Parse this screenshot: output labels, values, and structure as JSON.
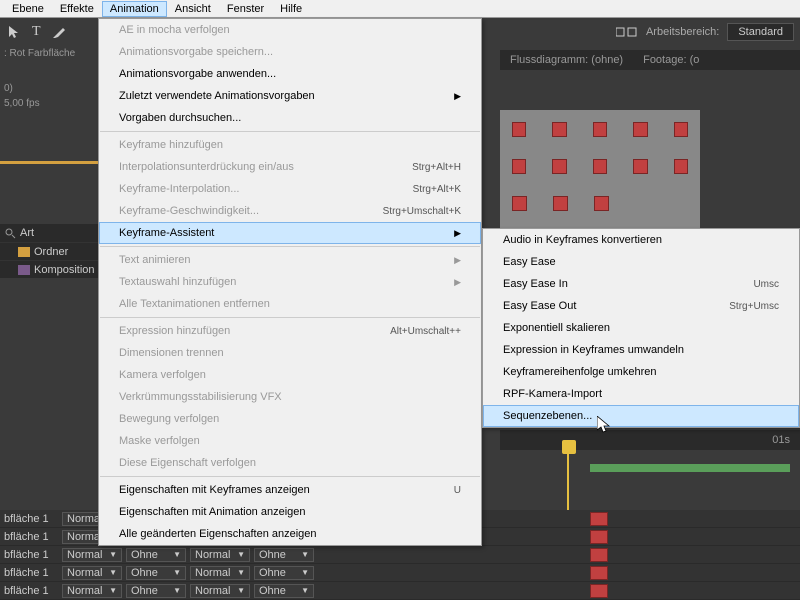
{
  "menubar": [
    "Ebene",
    "Effekte",
    "Animation",
    "Ansicht",
    "Fenster",
    "Hilfe"
  ],
  "menubar_active": "Animation",
  "workspace": {
    "label": "Arbeitsbereich:",
    "value": "Standard"
  },
  "project": {
    "title_line": ": Rot Farbfläche",
    "info1": "0)",
    "info2": "5,00 fps",
    "header": "Art",
    "rows": [
      "Ordner",
      "Komposition"
    ]
  },
  "panel_tabs": {
    "flow": "Flussdiagramm: (ohne)",
    "footage": "Footage: (o"
  },
  "dropdown_main": {
    "sections": [
      [
        {
          "label": "AE in mocha verfolgen",
          "disabled": true
        },
        {
          "label": "Animationsvorgabe speichern...",
          "disabled": true
        },
        {
          "label": "Animationsvorgabe anwenden..."
        },
        {
          "label": "Zuletzt verwendete Animationsvorgaben",
          "arrow": true
        },
        {
          "label": "Vorgaben durchsuchen..."
        }
      ],
      [
        {
          "label": "Keyframe hinzufügen",
          "disabled": true
        },
        {
          "label": "Interpolationsunterdrückung ein/aus",
          "shortcut": "Strg+Alt+H",
          "disabled": true
        },
        {
          "label": "Keyframe-Interpolation...",
          "shortcut": "Strg+Alt+K",
          "disabled": true
        },
        {
          "label": "Keyframe-Geschwindigkeit...",
          "shortcut": "Strg+Umschalt+K",
          "disabled": true
        },
        {
          "label": "Keyframe-Assistent",
          "arrow": true,
          "hover": true
        }
      ],
      [
        {
          "label": "Text animieren",
          "arrow": true,
          "disabled": true
        },
        {
          "label": "Textauswahl hinzufügen",
          "arrow": true,
          "disabled": true
        },
        {
          "label": "Alle Textanimationen entfernen",
          "disabled": true
        }
      ],
      [
        {
          "label": "Expression hinzufügen",
          "shortcut": "Alt+Umschalt++",
          "disabled": true
        },
        {
          "label": "Dimensionen trennen",
          "disabled": true
        },
        {
          "label": "Kamera verfolgen",
          "disabled": true
        },
        {
          "label": "Verkrümmungsstabilisierung VFX",
          "disabled": true
        },
        {
          "label": "Bewegung verfolgen",
          "disabled": true
        },
        {
          "label": "Maske verfolgen",
          "disabled": true
        },
        {
          "label": "Diese Eigenschaft verfolgen",
          "disabled": true
        }
      ],
      [
        {
          "label": "Eigenschaften mit Keyframes anzeigen",
          "shortcut": "U"
        },
        {
          "label": "Eigenschaften mit Animation anzeigen"
        },
        {
          "label": "Alle geänderten Eigenschaften anzeigen"
        }
      ]
    ]
  },
  "dropdown_sub": [
    {
      "label": "Audio in Keyframes konvertieren"
    },
    {
      "label": "Easy Ease"
    },
    {
      "label": "Easy Ease In",
      "shortcut": "Umsc"
    },
    {
      "label": "Easy Ease Out",
      "shortcut": "Strg+Umsc"
    },
    {
      "label": "Exponentiell skalieren"
    },
    {
      "label": "Expression in Keyframes umwandeln"
    },
    {
      "label": "Keyframereihenfolge umkehren"
    },
    {
      "label": "RPF-Kamera-Import"
    },
    {
      "label": "Sequenzebenen...",
      "hover": true
    }
  ],
  "timeline": {
    "ruler_mark": "01s",
    "layer_name": "bfläche 1",
    "blend_mode": "Normal",
    "track_matte": "Ohne",
    "layer_count": 5
  }
}
